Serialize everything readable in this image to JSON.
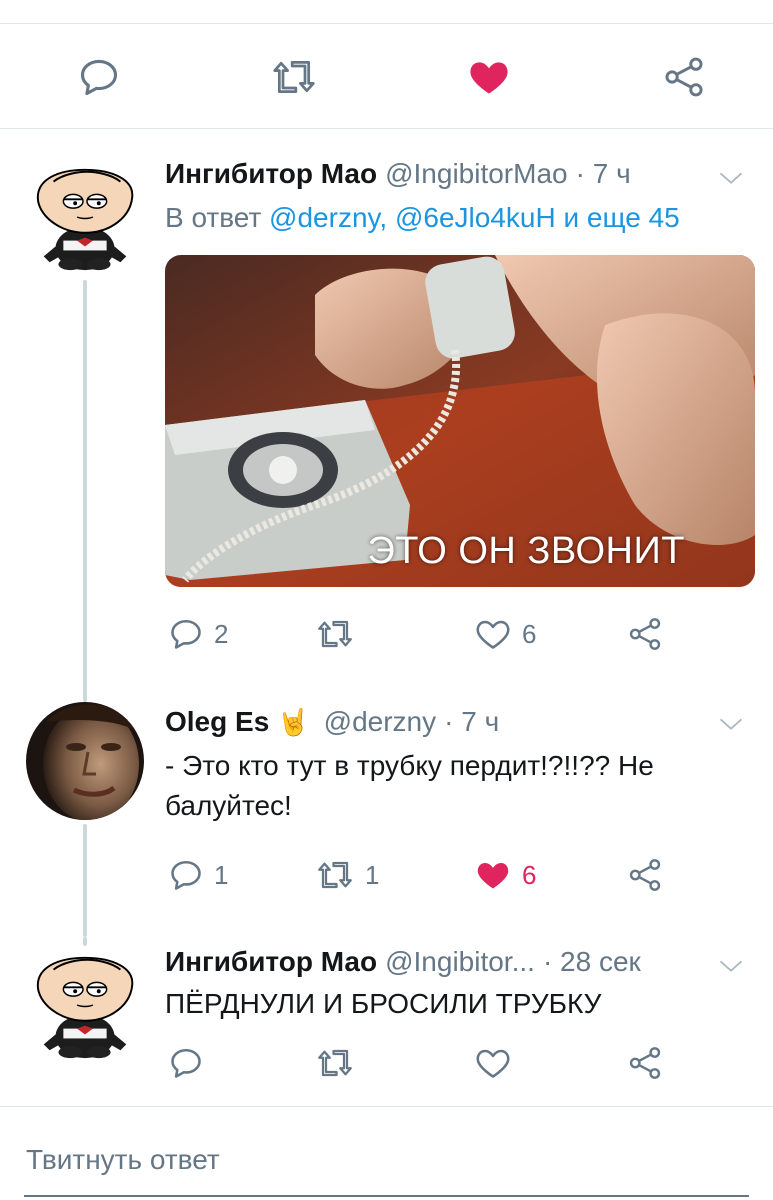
{
  "top_actions": {
    "liked": true,
    "colors": {
      "icon": "#657786",
      "like": "#e0245e"
    }
  },
  "tweets": [
    {
      "name": "Ингибитор Мао",
      "handle": "@IngibitorMao",
      "time": "· 7 ч",
      "reply_prefix": "В ответ ",
      "reply_links": "@derzny, @6eJlo4kuH и еще 45",
      "media_caption": "ЭТО ОН ЗВОНИТ",
      "actions": {
        "reply": "2",
        "retweet": "",
        "like": "6",
        "liked": false
      }
    },
    {
      "name": "Oleg Es",
      "badge_emoji": "🤘",
      "handle": "@derzny",
      "time": "· 7 ч",
      "text": "- Это кто тут в трубку пердит!?!!?? Не балуйтес!",
      "actions": {
        "reply": "1",
        "retweet": "1",
        "like": "6",
        "liked": true
      }
    },
    {
      "name": "Ингибитор Мао",
      "handle": "@Ingibitor...",
      "time": "· 28 сек",
      "text": "ПЁРДНУЛИ И БРОСИЛИ ТРУБКУ",
      "actions": {
        "reply": "",
        "retweet": "",
        "like": "",
        "liked": false
      }
    }
  ],
  "compose": {
    "placeholder": "Твитнуть ответ"
  }
}
